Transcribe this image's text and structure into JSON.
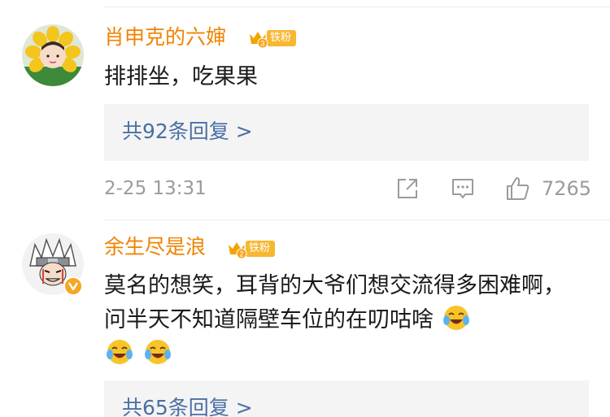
{
  "comments": [
    {
      "username": "肖申克的六婶",
      "badge": {
        "level": "3",
        "label": "铁粉"
      },
      "text": "排排坐，吃果果",
      "replies_label": "共92条回复 >",
      "timestamp": "2-25 13:31",
      "like_count": "7265",
      "avatar_icon": "sunflower-hat-avatar-icon"
    },
    {
      "username": "余生尽是浪",
      "badge": {
        "level": "2",
        "label": "铁粉"
      },
      "text": "莫名的想笑，耳背的大爷们想交流得多困难啊，问半天不知道隔壁车位的在叨咕啥",
      "replies_label": "共65条回复 >",
      "avatar_icon": "cartoon-ninja-avatar-icon",
      "emoji_icon": "laugh-cry-emoji-icon"
    }
  ],
  "colors": {
    "username": "#f08300",
    "badge": "#f7b731",
    "link": "#4a6fa5",
    "meta": "#9b9b9b",
    "reply_bg": "#f4f4f4"
  }
}
